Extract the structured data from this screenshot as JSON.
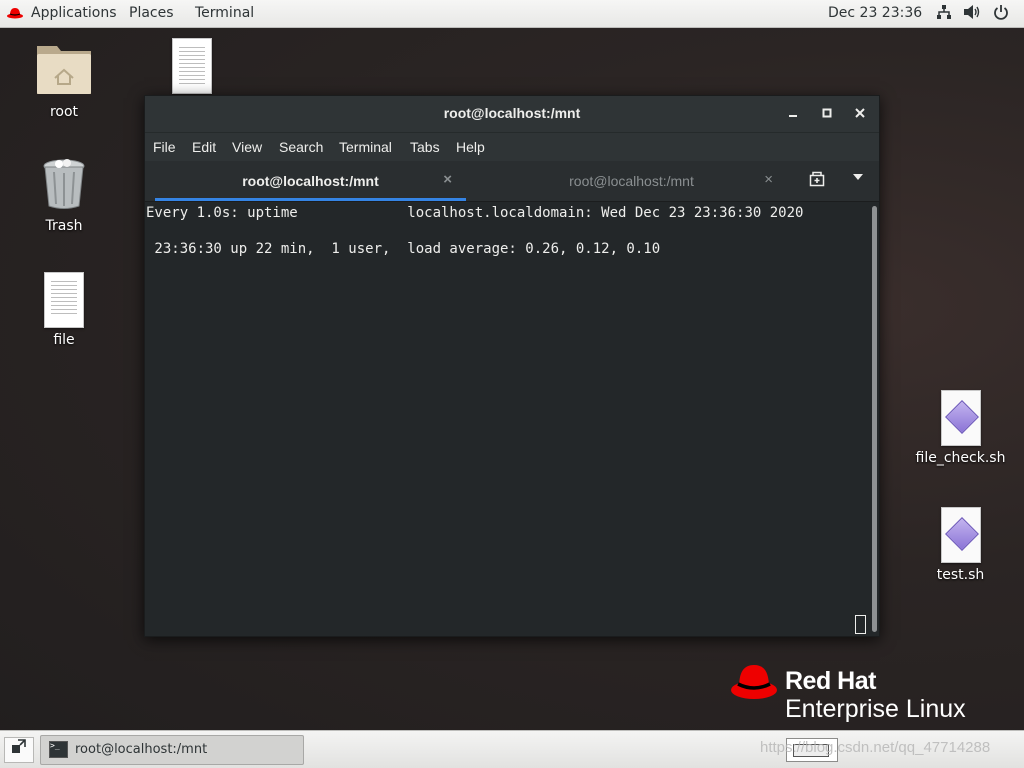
{
  "topbar": {
    "applications": "Applications",
    "places": "Places",
    "terminal": "Terminal",
    "clock": "Dec 23  23:36",
    "icons": [
      "network-icon",
      "volume-icon",
      "power-icon"
    ]
  },
  "desktop": {
    "icons": [
      {
        "label": "root",
        "icon": "home-folder-icon"
      },
      {
        "label": "Trash",
        "icon": "trash-icon"
      },
      {
        "label": "file",
        "icon": "document-icon"
      },
      {
        "label": "file_check.sh",
        "icon": "script-icon"
      },
      {
        "label": "test.sh",
        "icon": "script-icon"
      }
    ]
  },
  "window": {
    "title": "root@localhost:/mnt",
    "menu": [
      "File",
      "Edit",
      "View",
      "Search",
      "Terminal",
      "Tabs",
      "Help"
    ],
    "tabs": [
      {
        "label": "root@localhost:/mnt",
        "active": true
      },
      {
        "label": "root@localhost:/mnt",
        "active": false
      }
    ],
    "terminal_lines": [
      "Every 1.0s: uptime             localhost.localdomain: Wed Dec 23 23:36:30 2020",
      "",
      " 23:36:30 up 22 min,  1 user,  load average: 0.26, 0.12, 0.10"
    ]
  },
  "branding": {
    "line1": "Red Hat",
    "line2": "Enterprise Linux",
    "color": "#ee0000"
  },
  "taskbar": {
    "task_label": "root@localhost:/mnt",
    "watermark": "https://blog.csdn.net/qq_47714288"
  },
  "colors": {
    "accent": "#3584e4",
    "terminal_bg": "#232729",
    "redhat": "#ee0000"
  }
}
